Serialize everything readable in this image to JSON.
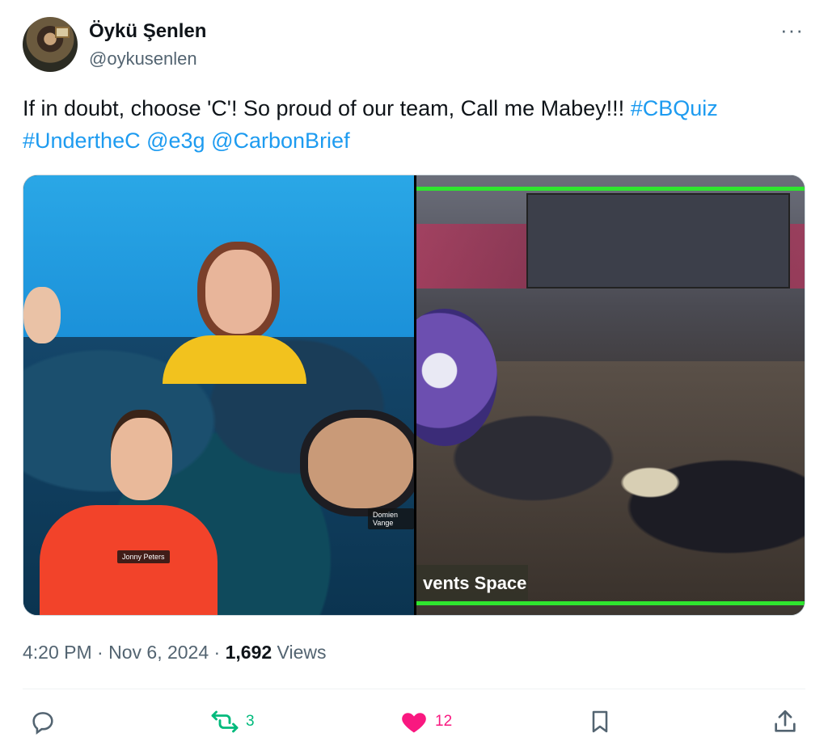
{
  "author": {
    "name": "Öykü Şenlen",
    "handle": "@oykusenlen"
  },
  "more_label": "···",
  "tweet": {
    "text_plain": "If in doubt, choose 'C'! So proud of our team, Call me Mabey!!! ",
    "links": [
      "#CBQuiz",
      "#UndertheC",
      "@e3g",
      "@CarbonBrief"
    ]
  },
  "media": {
    "left_tags": [
      "Jonny Peters",
      "Domien Vange"
    ],
    "right_label": "vents Space"
  },
  "meta": {
    "time": "4:20 PM",
    "date": "Nov 6, 2024",
    "views_count": "1,692",
    "views_label": "Views"
  },
  "actions": {
    "retweets": "3",
    "likes": "12"
  },
  "colors": {
    "link": "#1d9bf0",
    "retweet": "#00ba7c",
    "like": "#f91880",
    "muted": "#536471"
  },
  "icons": [
    "reply-icon",
    "retweet-icon",
    "heart-icon",
    "bookmark-icon",
    "share-icon",
    "more-icon"
  ]
}
